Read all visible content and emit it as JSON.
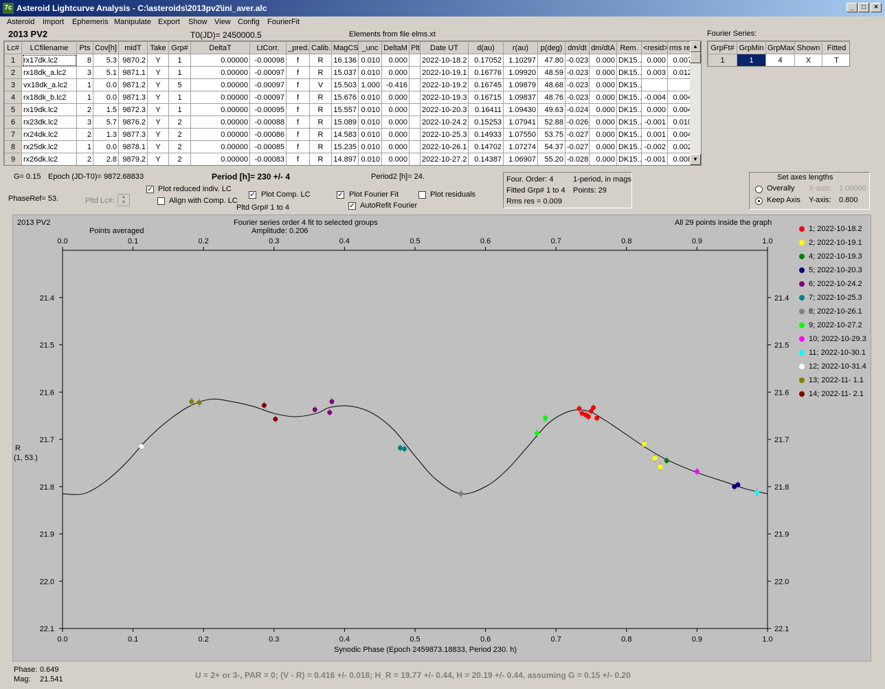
{
  "window": {
    "title": "Asteroid Lightcurve Analysis - C:\\asteroids\\2013pv2\\ini_aver.alc",
    "app_icon": "7c"
  },
  "menu": [
    "Asteroid",
    "Import",
    "Ephemeris",
    "Manipulate",
    "Export",
    "Show",
    "View",
    "Config",
    "FourierFit"
  ],
  "header": {
    "object": "2013 PV2",
    "t0": "T0(JD)= 2450000.5",
    "elements": "Elements from file elms.xt"
  },
  "table": {
    "columns": [
      "Lc#",
      "LCfilename",
      "Pts",
      "Cov[h]",
      "midT",
      "Take",
      "Grp#",
      "DeltaT",
      "LtCorr.",
      "_pred.",
      "Calib.",
      "MagCS",
      "_unc",
      "DeltaM",
      "Plt",
      "Date UT",
      "d(au)",
      "r(au)",
      "p(deg)",
      "dm/dt",
      "dm/dtA",
      "Rem.",
      "<resid>",
      "rms res"
    ],
    "rows": [
      [
        "1",
        "rx17dk.lc2",
        "8",
        "5.3",
        "9870.2",
        "Y",
        "1",
        "0.00000",
        "-0.00098",
        "f",
        "R",
        "16.136",
        "0.010",
        "0.000",
        "",
        "2022-10-18.2",
        "0.17052",
        "1.10297",
        "47.80",
        "-0.023",
        "0.000",
        "DK15..",
        "0.000",
        "0.007"
      ],
      [
        "2",
        "rx18dk_a.lc2",
        "3",
        "5.1",
        "9871.1",
        "Y",
        "1",
        "0.00000",
        "-0.00097",
        "f",
        "R",
        "15.037",
        "0.010",
        "0.000",
        "",
        "2022-10-19.1",
        "0.16776",
        "1.09920",
        "48.59",
        "-0.023",
        "0.000",
        "DK15..",
        "0.003",
        "0.012"
      ],
      [
        "3",
        "vx18dk_a.lc2",
        "1",
        "0.0",
        "9871.2",
        "Y",
        "5",
        "0.00000",
        "-0.00097",
        "f",
        "V",
        "15.503",
        "1.000",
        "-0.416",
        "",
        "2022-10-19.2",
        "0.16745",
        "1.09879",
        "48.68",
        "-0.023",
        "0.000",
        "DK15..",
        "",
        ""
      ],
      [
        "4",
        "rx18dk_b.lc2",
        "1",
        "0.0",
        "9871.3",
        "Y",
        "1",
        "0.00000",
        "-0.00097",
        "f",
        "R",
        "15.676",
        "0.010",
        "0.000",
        "",
        "2022-10-19.3",
        "0.16715",
        "1.09837",
        "48.76",
        "-0.023",
        "0.000",
        "DK15..",
        "-0.004",
        "0.004"
      ],
      [
        "5",
        "rx19dk.lc2",
        "2",
        "1.5",
        "9872.3",
        "Y",
        "1",
        "0.00000",
        "-0.00095",
        "f",
        "R",
        "15.557",
        "0.010",
        "0.000",
        "",
        "2022-10-20.3",
        "0.16411",
        "1.09430",
        "49.63",
        "-0.024",
        "0.000",
        "DK15..",
        "0.000",
        "0.004"
      ],
      [
        "6",
        "rx23dk.lc2",
        "3",
        "5.7",
        "9876.2",
        "Y",
        "2",
        "0.00000",
        "-0.00088",
        "f",
        "R",
        "15.089",
        "0.010",
        "0.000",
        "",
        "2022-10-24.2",
        "0.15253",
        "1.07941",
        "52.88",
        "-0.026",
        "0.000",
        "DK15..",
        "-0.001",
        "0.010"
      ],
      [
        "7",
        "rx24dk.lc2",
        "2",
        "1.3",
        "9877.3",
        "Y",
        "2",
        "0.00000",
        "-0.00086",
        "f",
        "R",
        "14.583",
        "0.010",
        "0.000",
        "",
        "2022-10-25.3",
        "0.14933",
        "1.07550",
        "53.75",
        "-0.027",
        "0.000",
        "DK15..",
        "0.001",
        "0.004"
      ],
      [
        "8",
        "rx25dk.lc2",
        "1",
        "0.0",
        "9878.1",
        "Y",
        "2",
        "0.00000",
        "-0.00085",
        "f",
        "R",
        "15.235",
        "0.010",
        "0.000",
        "",
        "2022-10-26.1",
        "0.14702",
        "1.07274",
        "54.37",
        "-0.027",
        "0.000",
        "DK15..",
        "-0.002",
        "0.002"
      ],
      [
        "9",
        "rx26dk.lc2",
        "2",
        "2.8",
        "9879.2",
        "Y",
        "2",
        "0.00000",
        "-0.00083",
        "f",
        "R",
        "14.897",
        "0.010",
        "0.000",
        "",
        "2022-10-27.2",
        "0.14387",
        "1.06907",
        "55.20",
        "-0.028",
        "0.000",
        "DK15..",
        "-0.001",
        "0.008"
      ]
    ]
  },
  "fourier_table": {
    "title": "Fourier Series:",
    "columns": [
      "GrpFt#",
      "GrpMin",
      "GrpMax",
      "Shown",
      "Fitted"
    ],
    "row": [
      "1",
      "1",
      "4",
      "X",
      "T"
    ]
  },
  "controls": {
    "g": "G= 0.15",
    "epoch": "Epoch (JD-T0)= 9872.68833",
    "period": "Period [h]= 230 +/- 4",
    "period2": "Period2 [h]= 24.",
    "phaseref": "PhaseRef= 53.",
    "pltd_lc": "Pltd Lc#:",
    "plot_reduced": "Plot reduced indiv. LC",
    "align_comp": "Align with Comp. LC",
    "plot_comp": "Plot Comp. LC",
    "pltd_grp": "Pltd Grp#  1   to   4",
    "plot_fourier": "Plot Fourier Fit",
    "autorefit": "AutoRefit Fourier",
    "plot_resid": "Plot residuals",
    "checked": {
      "plot_reduced": true,
      "align_comp": false,
      "plot_comp": true,
      "plot_fourier": true,
      "autorefit": true,
      "plot_resid": false
    }
  },
  "fourier_info": {
    "order": "Four. Order:  4",
    "mode": "1-period, in mags",
    "fitted": "Fitted Grp# 1 to 4",
    "points": "Points: 29",
    "rms": "Rms res     = 0.009"
  },
  "axes_box": {
    "title": "Set axes lengths",
    "overally": "Overally",
    "keep": "Keep Axis",
    "xaxis_label": "X-axis:",
    "xaxis_val": "1.00000",
    "yaxis_label": "Y-axis:",
    "yaxis_val": "0.800",
    "selected": "keep"
  },
  "plot": {
    "object": "2013 PV2",
    "fourier_title": "Fourier series order 4 fit to selected groups",
    "amplitude": "Amplitude: 0.206",
    "points_avg": "Points averaged",
    "inside": "All 29 points inside the graph",
    "ylabel1": "R",
    "ylabel2": "(1, 53.)",
    "xlabel": "Synodic Phase (Epoch 2459873.18833, Period 230. h)"
  },
  "chart_data": {
    "type": "scatter",
    "xlim": [
      0.0,
      1.0
    ],
    "ylim": [
      21.3,
      22.1
    ],
    "y_inverted": true,
    "x_ticks": [
      "0.0",
      "0.1",
      "0.2",
      "0.3",
      "0.4",
      "0.5",
      "0.6",
      "0.7",
      "0.8",
      "0.9",
      "1.0"
    ],
    "y_ticks": [
      "21.4",
      "21.5",
      "21.6",
      "21.7",
      "21.8",
      "21.9",
      "22.0",
      "22.1"
    ],
    "fourier_curve": [
      [
        0.0,
        21.815
      ],
      [
        0.03,
        21.815
      ],
      [
        0.06,
        21.79
      ],
      [
        0.09,
        21.75
      ],
      [
        0.12,
        21.7
      ],
      [
        0.15,
        21.66
      ],
      [
        0.18,
        21.63
      ],
      [
        0.21,
        21.615
      ],
      [
        0.24,
        21.62
      ],
      [
        0.27,
        21.63
      ],
      [
        0.3,
        21.645
      ],
      [
        0.33,
        21.652
      ],
      [
        0.36,
        21.645
      ],
      [
        0.38,
        21.632
      ],
      [
        0.41,
        21.63
      ],
      [
        0.44,
        21.645
      ],
      [
        0.47,
        21.68
      ],
      [
        0.5,
        21.735
      ],
      [
        0.53,
        21.785
      ],
      [
        0.565,
        21.815
      ],
      [
        0.6,
        21.8
      ],
      [
        0.63,
        21.765
      ],
      [
        0.66,
        21.715
      ],
      [
        0.69,
        21.665
      ],
      [
        0.72,
        21.64
      ],
      [
        0.745,
        21.64
      ],
      [
        0.77,
        21.66
      ],
      [
        0.8,
        21.69
      ],
      [
        0.83,
        21.72
      ],
      [
        0.86,
        21.745
      ],
      [
        0.9,
        21.77
      ],
      [
        0.94,
        21.79
      ],
      [
        0.97,
        21.805
      ],
      [
        1.0,
        21.815
      ]
    ],
    "series": [
      {
        "name": "1; 2022-10-18.2",
        "color": "#ff0000",
        "points": [
          [
            0.733,
            21.635
          ],
          [
            0.737,
            21.645
          ],
          [
            0.742,
            21.648
          ],
          [
            0.746,
            21.652
          ],
          [
            0.75,
            21.64
          ],
          [
            0.753,
            21.633
          ],
          [
            0.758,
            21.655
          ]
        ]
      },
      {
        "name": "2; 2022-10-19.1",
        "color": "#ffff00",
        "points": [
          [
            0.825,
            21.71
          ],
          [
            0.84,
            21.74
          ],
          [
            0.848,
            21.758
          ]
        ]
      },
      {
        "name": "4; 2022-10-19.3",
        "color": "#008000",
        "points": [
          [
            0.857,
            21.745
          ]
        ]
      },
      {
        "name": "5; 2022-10-20.3",
        "color": "#000080",
        "points": [
          [
            0.953,
            21.8
          ],
          [
            0.958,
            21.796
          ]
        ]
      },
      {
        "name": "6; 2022-10-24.2",
        "color": "#800080",
        "points": [
          [
            0.358,
            21.637
          ],
          [
            0.379,
            21.643
          ],
          [
            0.382,
            21.62
          ]
        ]
      },
      {
        "name": "7; 2022-10-25.3",
        "color": "#008080",
        "points": [
          [
            0.479,
            21.718
          ],
          [
            0.485,
            21.72
          ]
        ]
      },
      {
        "name": "8; 2022-10-26.1",
        "color": "#808080",
        "points": [
          [
            0.565,
            21.815
          ]
        ]
      },
      {
        "name": "9; 2022-10-27.2",
        "color": "#00ff00",
        "points": [
          [
            0.673,
            21.687
          ],
          [
            0.685,
            21.655
          ]
        ]
      },
      {
        "name": "10; 2022-10-29.3",
        "color": "#ff00ff",
        "points": [
          [
            0.9,
            21.768
          ]
        ]
      },
      {
        "name": "11; 2022-10-30.1",
        "color": "#00ffff",
        "points": [
          [
            0.985,
            21.812
          ]
        ]
      },
      {
        "name": "12; 2022-10-31.4",
        "color": "#ffffff",
        "points": [
          [
            0.112,
            21.715
          ]
        ]
      },
      {
        "name": "13; 2022-11- 1.1",
        "color": "#808000",
        "points": [
          [
            0.183,
            21.62
          ],
          [
            0.194,
            21.622
          ]
        ]
      },
      {
        "name": "14; 2022-11- 2.1",
        "color": "#800000",
        "points": [
          [
            0.286,
            21.628
          ],
          [
            0.302,
            21.657
          ]
        ]
      }
    ]
  },
  "status": {
    "phase_label": "Phase:",
    "phase_val": "0.649",
    "mag_label": "Mag:",
    "mag_val": "21.541",
    "formula": "U = 2+ or 3-, PAR = 0; (V - R) = 0.416 +/- 0.018; H_R = 19.77 +/- 0.44, H = 20.19 +/- 0.44, assuming G = 0.15 +/- 0.20"
  }
}
